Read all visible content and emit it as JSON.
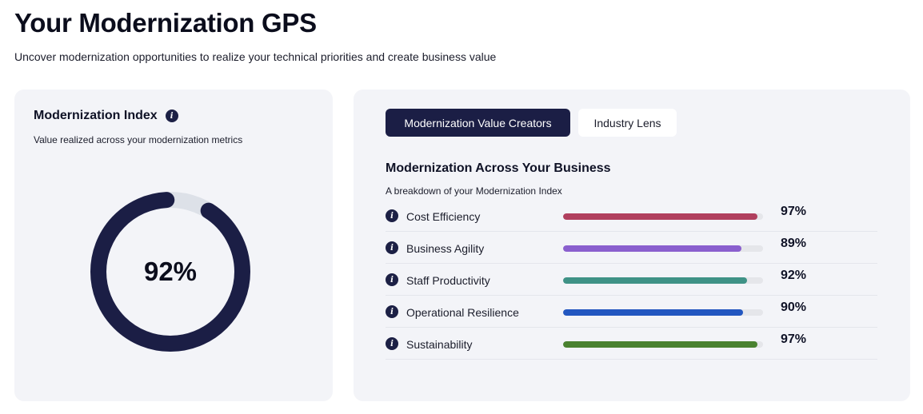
{
  "header": {
    "title": "Your Modernization GPS",
    "subtitle": "Uncover modernization opportunities to realize your technical priorities and create business value"
  },
  "index_card": {
    "title": "Modernization Index",
    "description": "Value realized across your modernization metrics",
    "value_label": "92%",
    "value": 92,
    "colors": {
      "fill": "#1b1e45",
      "track": "#dde1e8"
    }
  },
  "tabs": [
    {
      "label": "Modernization Value Creators",
      "active": true
    },
    {
      "label": "Industry Lens",
      "active": false
    }
  ],
  "breakdown": {
    "title": "Modernization Across Your Business",
    "description": "A breakdown of your Modernization Index",
    "metrics": [
      {
        "label": "Cost Efficiency",
        "value": 97,
        "value_label": "97%",
        "color": "#b03f5e"
      },
      {
        "label": "Business Agility",
        "value": 89,
        "value_label": "89%",
        "color": "#8a5fce"
      },
      {
        "label": "Staff Productivity",
        "value": 92,
        "value_label": "92%",
        "color": "#3f9286"
      },
      {
        "label": "Operational Resilience",
        "value": 90,
        "value_label": "90%",
        "color": "#2357c0"
      },
      {
        "label": "Sustainability",
        "value": 97,
        "value_label": "97%",
        "color": "#4a8230"
      }
    ]
  },
  "icons": {
    "info": "info-icon"
  }
}
